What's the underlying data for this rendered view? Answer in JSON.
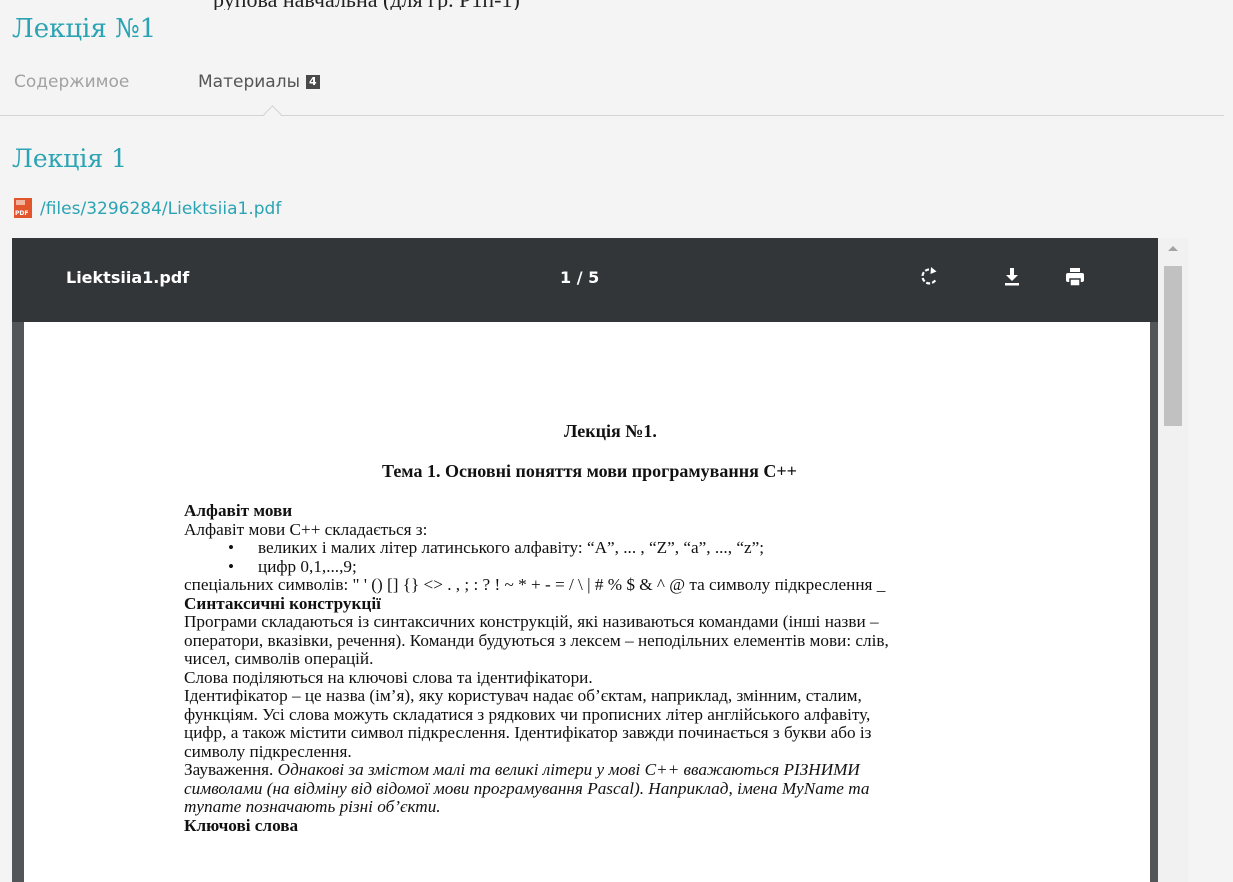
{
  "top_fragment": "рупова навчальна (для гр. Р1п-1)",
  "page": {
    "title": "Лекція №1",
    "tabs": [
      {
        "label": "Содержимое",
        "active": false
      },
      {
        "label": "Материалы",
        "badge": "4",
        "active": true
      }
    ]
  },
  "section": {
    "title": "Лекція 1",
    "file_link": "/files/3296284/Liektsiia1.pdf",
    "file_icon": "pdf-file-icon"
  },
  "viewer": {
    "filename": "Liektsiia1.pdf",
    "page_indicator": "1 / 5",
    "actions": [
      "rotate-icon",
      "download-icon",
      "print-icon"
    ]
  },
  "document": {
    "title": "Лекція №1.",
    "subtitle": "Тема 1. Основні поняття мови програмування С++",
    "lines": [
      "Алфавіт мови",
      "Алфавіт мови С++ складається з:",
      "великих і малих літер латинського алфавіту: “A”, ... , “Z”, “a”, ..., “z”;",
      "цифр 0,1,...,9;",
      "спеціальних символів: \" ' () [] {} <> . , ; : ? ! ~ * + - = / \\ | # % $ & ^ @ та символу підкреслення _",
      "Синтаксичні конструкції",
      "Програми складаються із синтаксичних конструкцій, які називаються командами (інші назви –",
      "оператори, вказівки, речення).  Команди будуються з лексем – неподільних елементів мови: слів,",
      "чисел, символів операцій.",
      "Слова поділяються на ключові слова та ідентифікатори.",
      "Ідентифікатор – це назва (ім’я), яку користувач надає об’єктам, наприклад, змінним, сталим,",
      "функціям. Усі слова можуть складатися з рядкових чи прописних літер англійського алфавіту,",
      "цифр, а також містити символ підкреслення. Ідентифікатор завжди починається з букви або із",
      "символу підкреслення.",
      "Зауваження.",
      "Однакові за змістом малі та великі літери у мові С++ вважаються РІЗНИМИ",
      "символами (на відміну від відомої мови програмування Pascal). Наприклад, імена MyName та",
      "myname позначають різні об’єкти.",
      "Ключові слова"
    ]
  },
  "colors": {
    "accent": "#2ba3b3",
    "toolbar": "#323639",
    "viewer_bg": "#525659"
  }
}
